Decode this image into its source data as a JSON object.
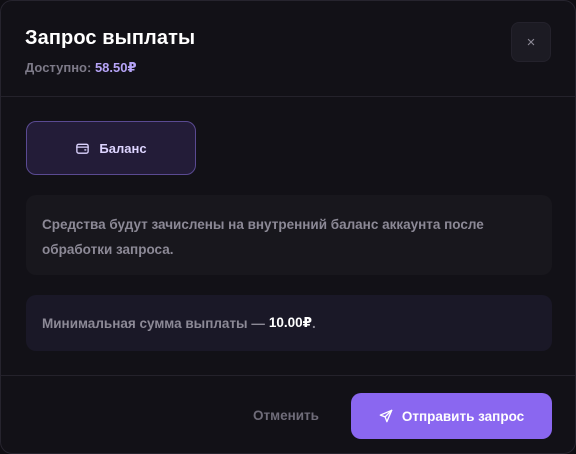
{
  "dialog": {
    "title": "Запрос выплаты",
    "available_label": "Доступно:",
    "available_amount": "58.50₽",
    "close_glyph": "×"
  },
  "method": {
    "label": "Баланс",
    "icon": "wallet-icon"
  },
  "info": {
    "text": "Средства будут зачислены на внутренний баланс аккаунта после обработки запроса."
  },
  "minimum": {
    "text": "Минимальная сумма выплаты —",
    "amount": "10.00₽",
    "suffix": "."
  },
  "footer": {
    "cancel_label": "Отменить",
    "submit_label": "Отправить запрос",
    "submit_icon": "send-icon"
  },
  "colors": {
    "accent": "#8a67f0",
    "accent_text": "#b6a4f7",
    "background": "#121117"
  }
}
